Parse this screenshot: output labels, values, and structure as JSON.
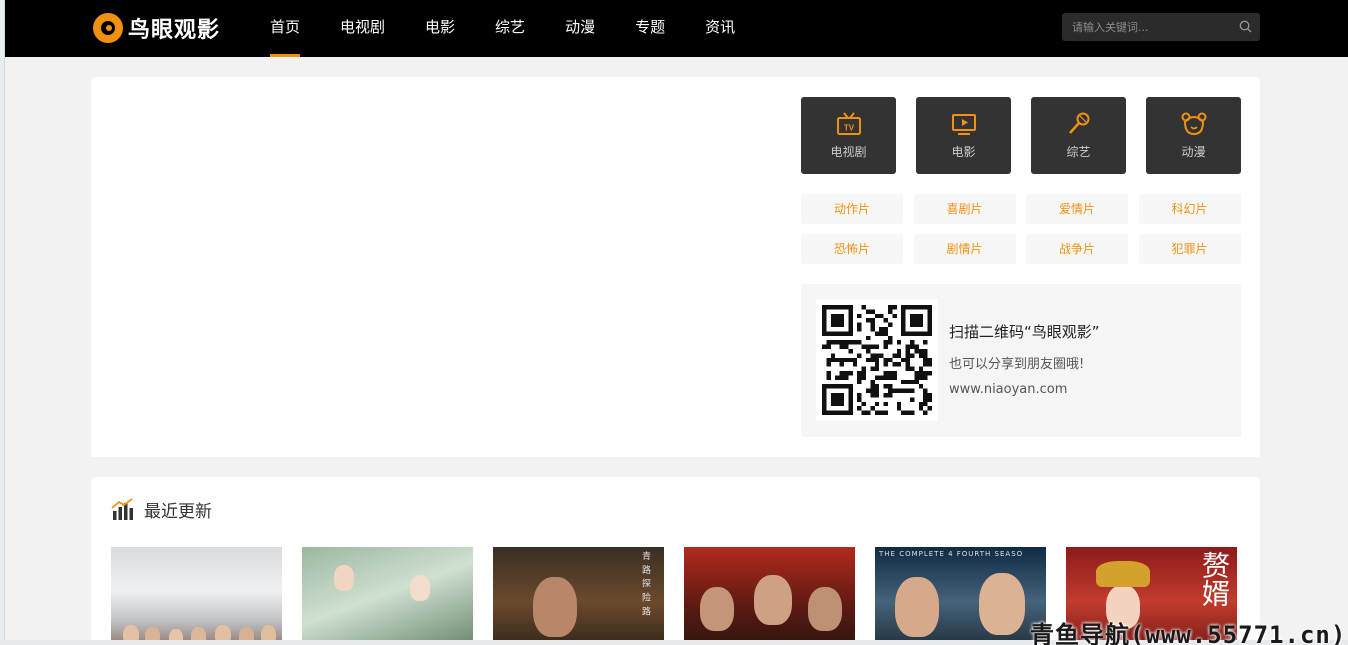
{
  "header": {
    "logo_text": "鸟眼观影",
    "nav": [
      {
        "label": "首页",
        "active": true
      },
      {
        "label": "电视剧",
        "active": false
      },
      {
        "label": "电影",
        "active": false
      },
      {
        "label": "综艺",
        "active": false
      },
      {
        "label": "动漫",
        "active": false
      },
      {
        "label": "专题",
        "active": false
      },
      {
        "label": "资讯",
        "active": false
      }
    ],
    "search": {
      "placeholder": "请输入关键词...",
      "icon": "search-icon"
    }
  },
  "hero": {
    "categories": [
      {
        "label": "电视剧",
        "icon": "tv-icon"
      },
      {
        "label": "电影",
        "icon": "screen-play-icon"
      },
      {
        "label": "综艺",
        "icon": "microphone-icon"
      },
      {
        "label": "动漫",
        "icon": "bear-face-icon"
      }
    ],
    "genres": [
      "动作片",
      "喜剧片",
      "爱情片",
      "科幻片",
      "恐怖片",
      "剧情片",
      "战争片",
      "犯罪片"
    ],
    "qr": {
      "title": "扫描二维码“鸟眼观影”",
      "subtitle": "也可以分享到朋友圈哦!",
      "url": "www.niaoyan.com"
    }
  },
  "recent": {
    "title": "最近更新",
    "icon": "bar-chart-icon",
    "posters": [
      {
        "text": ""
      },
      {
        "text": ""
      },
      {
        "text": "青 路 探 险 路"
      },
      {
        "text": ""
      },
      {
        "text": "THE COMPLETE 4 FOURTH SEASO"
      },
      {
        "text": "赘婿"
      }
    ]
  },
  "watermark": "青鱼导航(www.55771.cn)",
  "colors": {
    "accent": "#f29111",
    "header_bg": "#000000",
    "category_bg": "#333333"
  }
}
